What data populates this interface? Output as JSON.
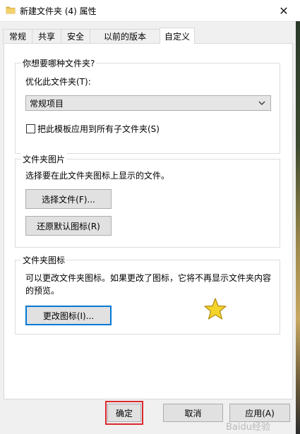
{
  "window": {
    "title": "新建文件夹 (4) 属性",
    "close_glyph": "✕"
  },
  "tabs": [
    {
      "label": "常规"
    },
    {
      "label": "共享"
    },
    {
      "label": "安全"
    },
    {
      "label": "以前的版本"
    },
    {
      "label": "自定义",
      "active": true
    }
  ],
  "optimize": {
    "group_title": "你想要哪种文件夹?",
    "label": "优化此文件夹(T):",
    "selected": "常规项目",
    "apply_sub_label": "把此模板应用到所有子文件夹(S)",
    "apply_sub_checked": false
  },
  "picture": {
    "group_title": "文件夹图片",
    "description": "选择要在此文件夹图标上显示的文件。",
    "choose_label": "选择文件(F)...",
    "restore_label": "还原默认图标(R)"
  },
  "icon": {
    "group_title": "文件夹图标",
    "description": "可以更改文件夹图标。如果更改了图标，它将不再显示文件夹内容的预览。",
    "change_label": "更改图标(I)..."
  },
  "footer": {
    "ok_label": "确定",
    "cancel_label": "取消",
    "apply_label": "应用(A)"
  },
  "watermark": "Baidu经验",
  "colors": {
    "focus_border": "#0078d7",
    "highlight_red": "#d9262c",
    "star_fill": "#f5d42a"
  }
}
